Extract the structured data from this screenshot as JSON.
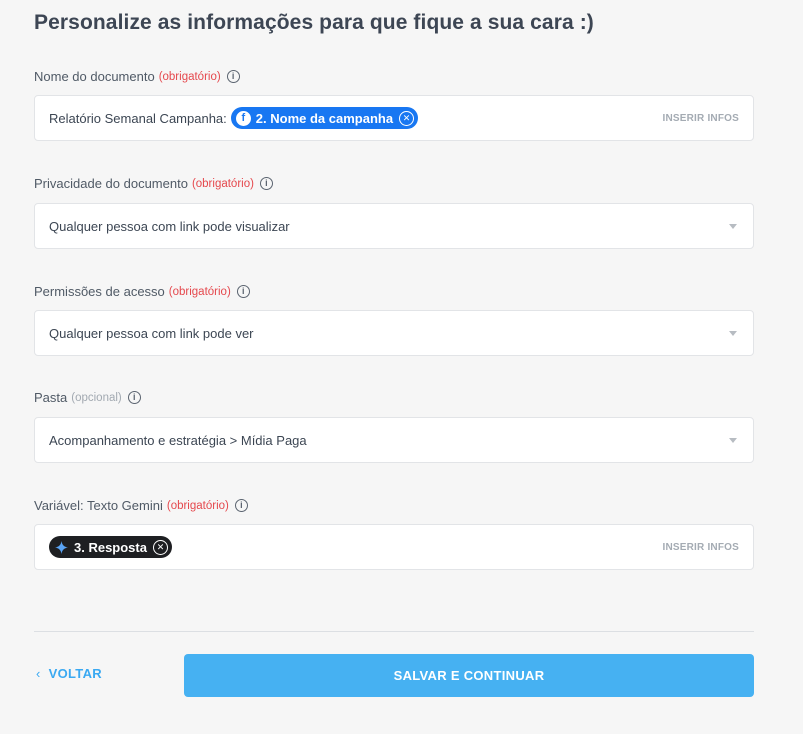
{
  "title": "Personalize as informações para que fique a sua cara :)",
  "fields": {
    "nome": {
      "label": "Nome do documento",
      "required": "(obrigatório)",
      "prefix_text": "Relatório Semanal Campanha:",
      "chip_label": "2. Nome da campanha",
      "insert_link": "INSERIR INFOS"
    },
    "privacidade": {
      "label": "Privacidade do documento",
      "required": "(obrigatório)",
      "value": "Qualquer pessoa com link pode visualizar"
    },
    "permissoes": {
      "label": "Permissões de acesso",
      "required": "(obrigatório)",
      "value": "Qualquer pessoa com link pode ver"
    },
    "pasta": {
      "label": "Pasta",
      "optional": "(opcional)",
      "value": "Acompanhamento e estratégia > Mídia Paga"
    },
    "variavel": {
      "label": "Variável: Texto Gemini",
      "required": "(obrigatório)",
      "chip_label": "3. Resposta",
      "insert_link": "INSERIR INFOS"
    }
  },
  "footer": {
    "back_label": "VOLTAR",
    "save_label": "SALVAR E CONTINUAR"
  },
  "colors": {
    "accent": "#46b1f2",
    "required": "#e5484d",
    "facebook_chip": "#1877f2",
    "gemini_chip": "#1e1f22"
  },
  "icons": [
    "info-icon",
    "facebook-icon",
    "gemini-sparkle-icon",
    "close-circle-icon",
    "chevron-left-icon",
    "caret-down-icon"
  ]
}
